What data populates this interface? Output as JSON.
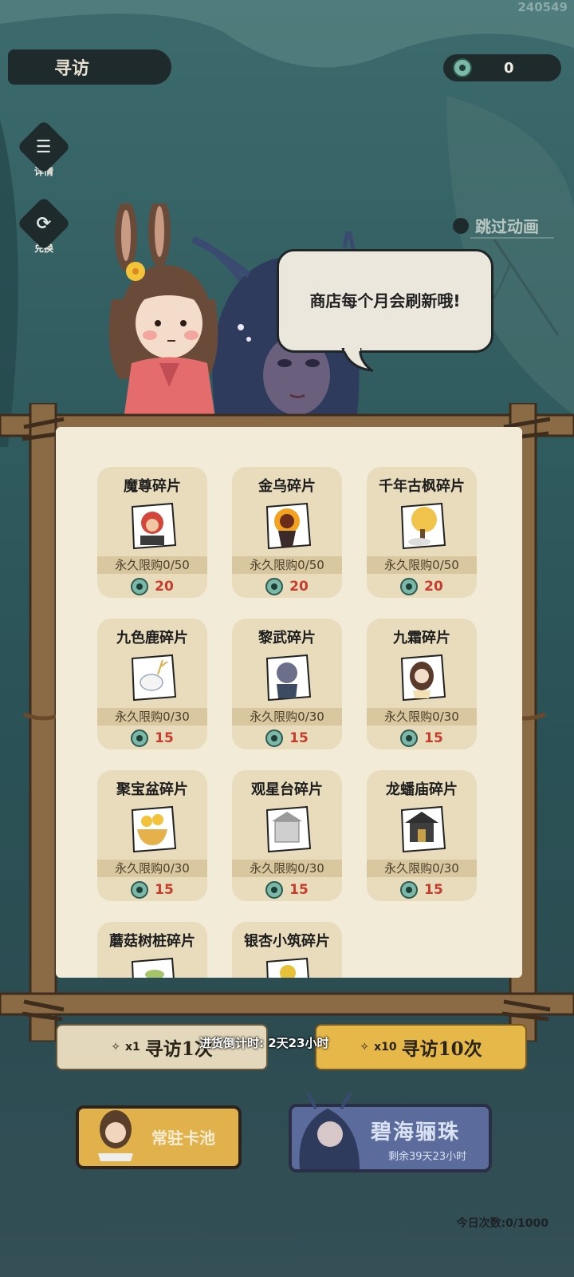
{
  "header": {
    "build_id": "240549",
    "title": "寻访",
    "currency_value": "0",
    "currency_icon": "jade-coin-icon"
  },
  "side_buttons": [
    {
      "label": "详情",
      "icon": "details-list-icon"
    },
    {
      "label": "兑换",
      "icon": "exchange-cycle-icon"
    }
  ],
  "skip_animation": "跳过动画",
  "dialog": {
    "text": "商店每个月会刷新哦!"
  },
  "shop": {
    "items": [
      {
        "name": "魔尊碎片",
        "limit": "永久限购0/50",
        "price": "20",
        "icon": "demon-lord-portrait-icon"
      },
      {
        "name": "金乌碎片",
        "limit": "永久限购0/50",
        "price": "20",
        "icon": "golden-crow-portrait-icon"
      },
      {
        "name": "千年古枫碎片",
        "limit": "永久限购0/50",
        "price": "20",
        "icon": "ancient-maple-tree-icon"
      },
      {
        "name": "九色鹿碎片",
        "limit": "永久限购0/30",
        "price": "15",
        "icon": "nine-color-deer-icon"
      },
      {
        "name": "黎武碎片",
        "limit": "永久限购0/30",
        "price": "15",
        "icon": "liwu-portrait-icon"
      },
      {
        "name": "九霜碎片",
        "limit": "永久限购0/30",
        "price": "15",
        "icon": "jiushuang-portrait-icon"
      },
      {
        "name": "聚宝盆碎片",
        "limit": "永久限购0/30",
        "price": "15",
        "icon": "treasure-bowl-icon"
      },
      {
        "name": "观星台碎片",
        "limit": "永久限购0/30",
        "price": "15",
        "icon": "star-watching-tower-icon"
      },
      {
        "name": "龙蟠庙碎片",
        "limit": "永久限购0/30",
        "price": "15",
        "icon": "dragon-temple-icon"
      },
      {
        "name": "蘑菇树桩碎片",
        "limit": "",
        "price": "",
        "icon": "mushroom-stump-icon"
      },
      {
        "name": "银杏小筑碎片",
        "limit": "",
        "price": "",
        "icon": "ginkgo-cottage-icon"
      }
    ]
  },
  "restock": "进货倒计时: 2天23小时",
  "draw_buttons": {
    "single_mult": "x1",
    "single_label": "寻访1次",
    "ten_mult": "x10",
    "ten_label": "寻访10次"
  },
  "pools": {
    "standard_label": "常驻卡池",
    "limited_label": "碧海骊珠",
    "limited_remaining": "剩余39天23小时"
  },
  "daily_count": "今日次数:0/1000",
  "colors": {
    "accent_gold": "#e6b84a",
    "price_red": "#c63d2d",
    "jade": "#7bb8a7",
    "paper": "#f1ebd8"
  }
}
